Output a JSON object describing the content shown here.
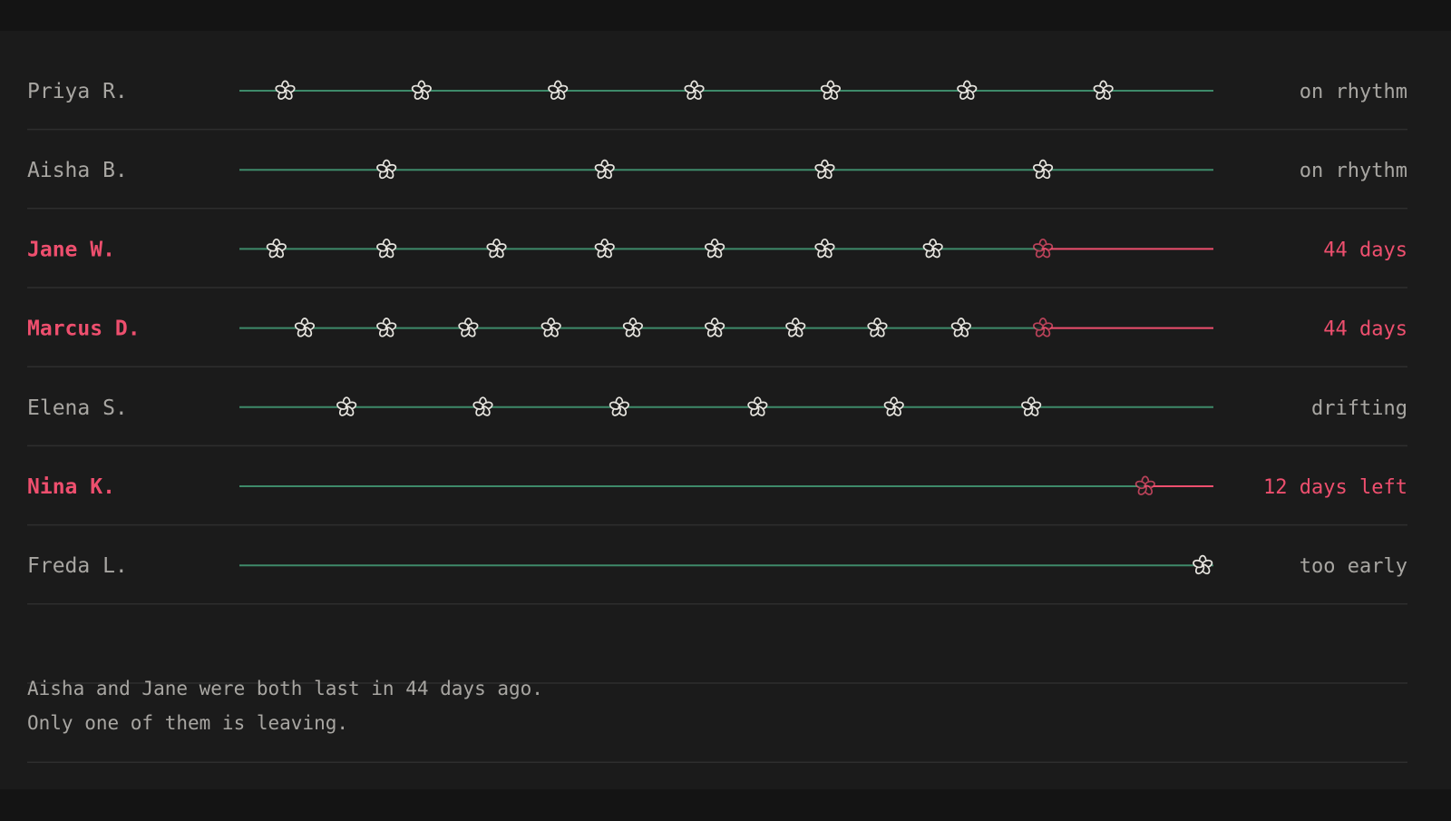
{
  "chart_data": {
    "type": "scatter",
    "x_unit": "timeline (earliest visit to today)",
    "rows": [
      {
        "name": "Priya R.",
        "status": "on rhythm",
        "flagged": false,
        "visits": [
          0.047,
          0.187,
          0.327,
          0.467,
          0.607,
          0.747,
          0.887
        ],
        "break_at": null
      },
      {
        "name": "Aisha B.",
        "status": "on rhythm",
        "flagged": false,
        "visits": [
          0.151,
          0.375,
          0.601,
          0.825
        ],
        "break_at": null
      },
      {
        "name": "Jane W.",
        "status": "44 days",
        "flagged": true,
        "visits": [
          0.038,
          0.151,
          0.264,
          0.375,
          0.488,
          0.601,
          0.712
        ],
        "faded_visits": [
          0.825
        ],
        "break_at": 0.825
      },
      {
        "name": "Marcus D.",
        "status": "44 days",
        "flagged": true,
        "visits": [
          0.067,
          0.151,
          0.235,
          0.32,
          0.404,
          0.488,
          0.571,
          0.655,
          0.741
        ],
        "faded_visits": [
          0.825
        ],
        "break_at": 0.825
      },
      {
        "name": "Elena S.",
        "status": "drifting",
        "flagged": false,
        "visits": [
          0.11,
          0.25,
          0.39,
          0.532,
          0.672,
          0.813
        ],
        "break_at": null
      },
      {
        "name": "Nina K.",
        "status": "12 days left",
        "flagged": true,
        "visits": [],
        "faded_visits": [
          0.93
        ],
        "break_at": 0.93
      },
      {
        "name": "Freda L.",
        "status": "too early",
        "flagged": false,
        "visits": [
          0.989
        ],
        "break_at": null
      }
    ]
  },
  "caption": {
    "line1": "Aisha and Jane were both last in 44 days ago.",
    "line2": "Only one of them is leaving."
  },
  "colors": {
    "background": "#141414",
    "panel": "#1b1b1b",
    "track": "#3e8a6a",
    "alert": "#ee4f6e",
    "flower": "#e7e5df",
    "text": "#a8a6a2",
    "rule": "#2e2e2e"
  },
  "icons": {
    "visit_marker": "five-petal-flower-icon"
  }
}
